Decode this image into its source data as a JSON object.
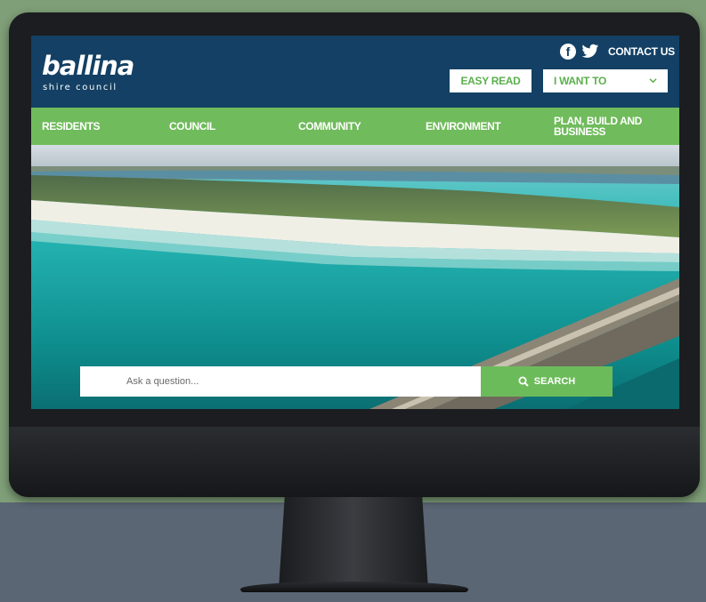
{
  "site": {
    "logo_main": "ballina",
    "logo_sub": "shire council"
  },
  "header": {
    "contact_label": "CONTACT US",
    "easy_read_label": "EASY READ",
    "i_want_to_label": "I WANT TO"
  },
  "nav": {
    "items": [
      {
        "label": "RESIDENTS"
      },
      {
        "label": "COUNCIL"
      },
      {
        "label": "COMMUNITY"
      },
      {
        "label": "ENVIRONMENT"
      },
      {
        "label": "PLAN, BUILD AND BUSINESS"
      }
    ]
  },
  "search": {
    "placeholder": "Ask a question...",
    "button_label": "SEARCH"
  },
  "icons": {
    "social": [
      "facebook-icon",
      "twitter-icon"
    ],
    "dropdown": "chevron-down-icon",
    "search": "search-icon"
  },
  "colors": {
    "header_bg": "#134064",
    "nav_green": "#70bb5c",
    "button_text_green": "#5bb04d",
    "search_green": "#6cbb5b",
    "backdrop_top": "#7f9f78",
    "backdrop_bottom": "#5b6674"
  }
}
